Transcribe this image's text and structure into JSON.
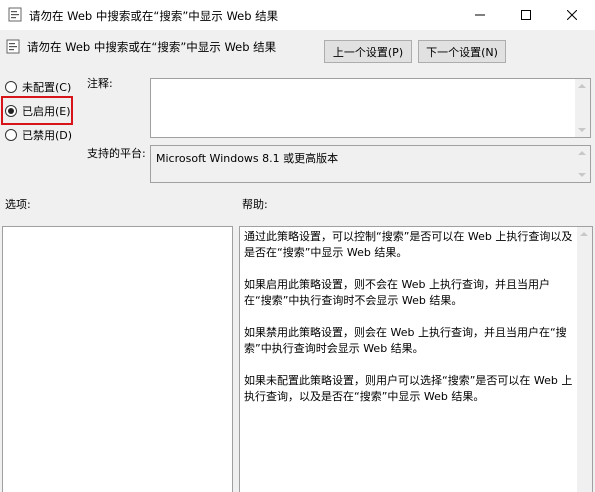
{
  "window": {
    "title": "请勿在 Web 中搜索或在“搜索”中显示 Web 结果"
  },
  "header": {
    "policy_title": "请勿在 Web 中搜索或在“搜索”中显示 Web 结果",
    "prev_button": "上一个设置(P)",
    "next_button": "下一个设置(N)"
  },
  "state_options": [
    {
      "label": "未配置(C)",
      "checked": false
    },
    {
      "label": "已启用(E)",
      "checked": true
    },
    {
      "label": "已禁用(D)",
      "checked": false
    }
  ],
  "comment": {
    "label": "注释:",
    "value": ""
  },
  "platform": {
    "label": "支持的平台:",
    "value": "Microsoft Windows 8.1 或更高版本"
  },
  "options": {
    "label": "选项:"
  },
  "help": {
    "label": "帮助:",
    "paragraphs": [
      "通过此策略设置，可以控制“搜索”是否可以在 Web 上执行查询以及是否在“搜索”中显示 Web 结果。",
      "如果启用此策略设置，则不会在 Web 上执行查询，并且当用户在“搜索”中执行查询时不会显示 Web 结果。",
      "如果禁用此策略设置，则会在 Web 上执行查询，并且当用户在“搜索”中执行查询时会显示 Web 结果。",
      "如果未配置此策略设置，则用户可以选择“搜索”是否可以在 Web 上执行查询，以及是否在“搜索”中显示 Web 结果。"
    ]
  },
  "colors": {
    "highlight": "#d7141a",
    "background": "#f0f0f0"
  }
}
